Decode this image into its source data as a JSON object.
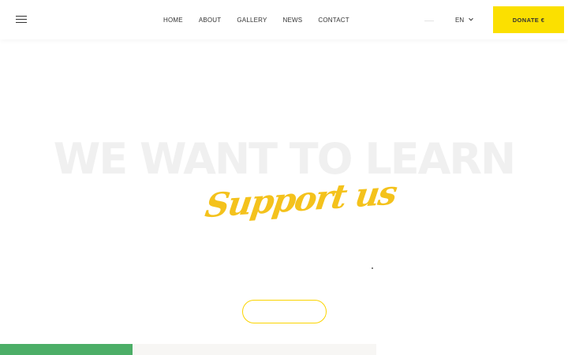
{
  "header": {
    "menu_icon": "hamburger-menu-icon",
    "nav": [
      {
        "label": "HOME"
      },
      {
        "label": "ABOUT"
      },
      {
        "label": "GALLERY"
      },
      {
        "label": "NEWS"
      },
      {
        "label": "CONTACT"
      }
    ],
    "language": "EN",
    "language_icon": "chevron-down-icon",
    "donate_label": "DONATE €",
    "accent_color": "#fbe000"
  },
  "hero": {
    "background_title": "WE WANT TO LEARN",
    "script_title": "Support us",
    "script_color": "#f4c21c",
    "cta_label": ""
  },
  "footer_strip": {
    "green_color": "#4cae67",
    "grey_color": "#f7f6f4"
  }
}
